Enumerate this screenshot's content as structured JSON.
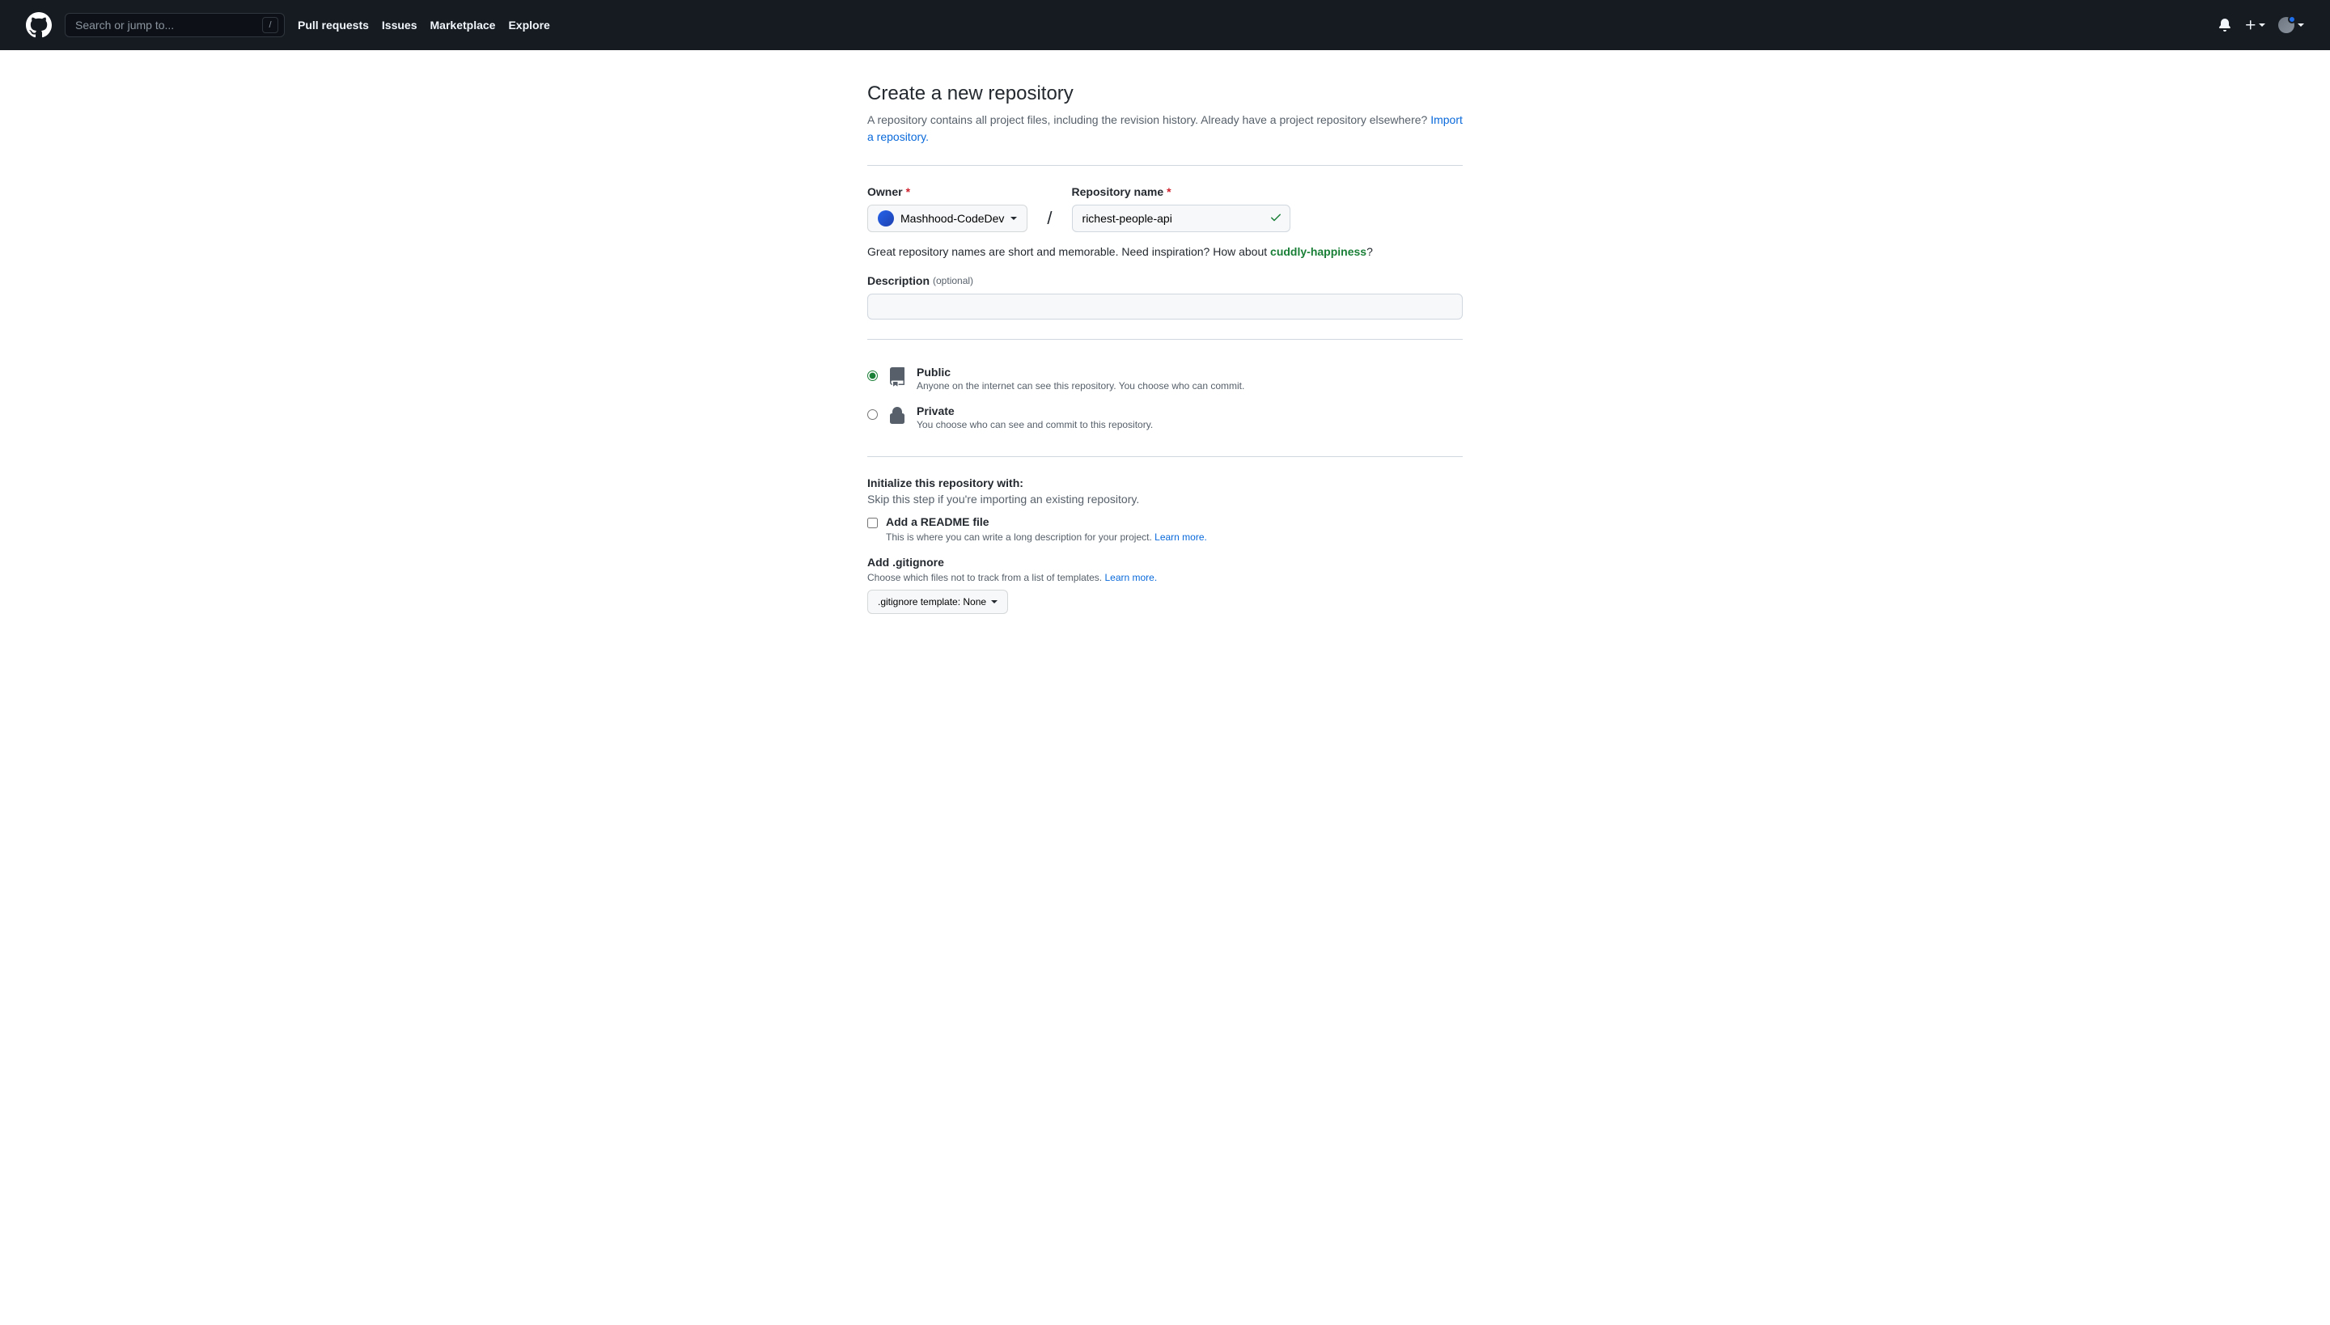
{
  "header": {
    "search_placeholder": "Search or jump to...",
    "nav": [
      "Pull requests",
      "Issues",
      "Marketplace",
      "Explore"
    ]
  },
  "page": {
    "title": "Create a new repository",
    "subhead_1": "A repository contains all project files, including the revision history. Already have a project repository elsewhere? ",
    "import_link": "Import a repository."
  },
  "owner": {
    "label": "Owner",
    "value": "Mashhood-CodeDev"
  },
  "repo": {
    "label": "Repository name",
    "value": "richest-people-api"
  },
  "hint": {
    "prefix": "Great repository names are short and memorable. Need inspiration? How about ",
    "suggestion": "cuddly-happiness",
    "suffix": "?"
  },
  "description": {
    "label": "Description",
    "optional": "(optional)"
  },
  "visibility": {
    "public": {
      "label": "Public",
      "desc": "Anyone on the internet can see this repository. You choose who can commit."
    },
    "private": {
      "label": "Private",
      "desc": "You choose who can see and commit to this repository."
    }
  },
  "init": {
    "heading": "Initialize this repository with:",
    "sub": "Skip this step if you're importing an existing repository.",
    "readme": {
      "label": "Add a README file",
      "desc": "This is where you can write a long description for your project. ",
      "learn": "Learn more."
    },
    "gitignore": {
      "label": "Add .gitignore",
      "desc": "Choose which files not to track from a list of templates. ",
      "learn": "Learn more.",
      "button": ".gitignore template: None"
    }
  }
}
